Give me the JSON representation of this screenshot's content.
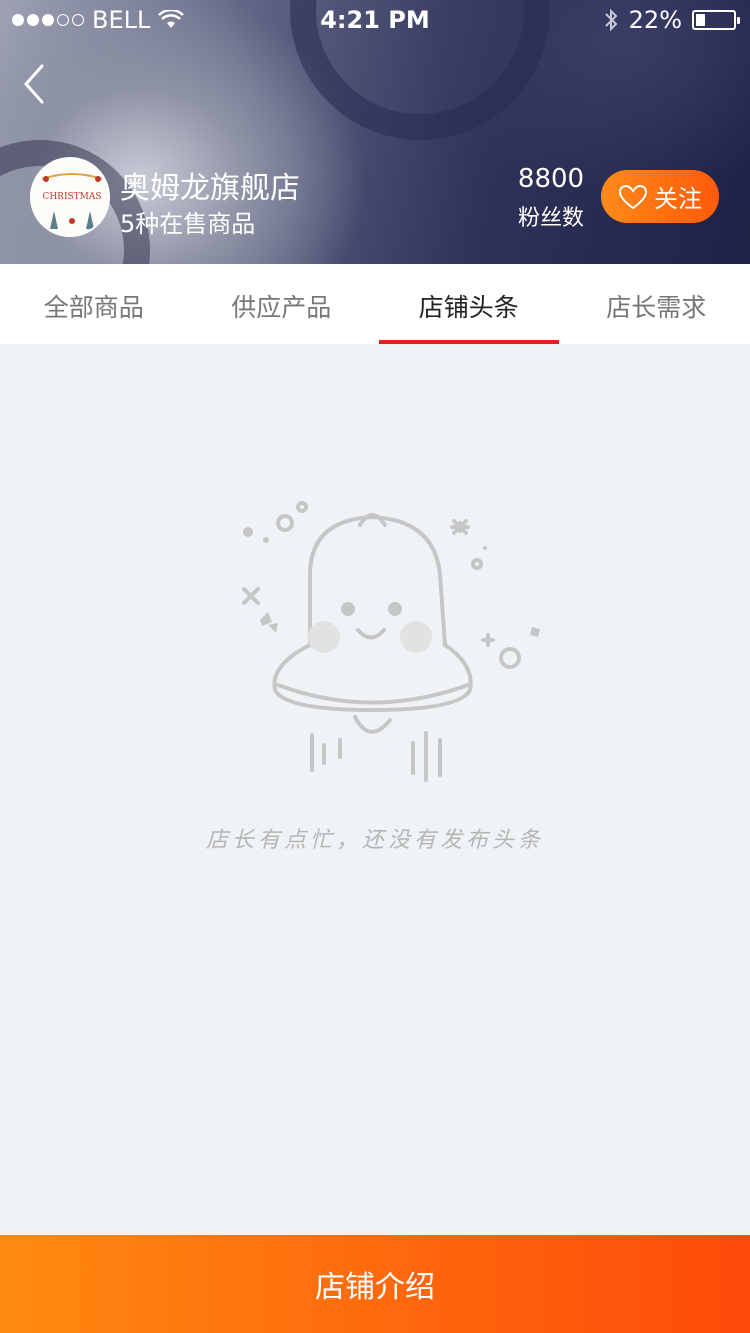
{
  "status_bar": {
    "carrier": "BELL",
    "time": "4:21 PM",
    "battery": "22%",
    "battery_level": 0.22,
    "signal_icon": "signal-dots-icon",
    "wifi_icon": "wifi-icon",
    "bluetooth_icon": "bluetooth-icon"
  },
  "header": {
    "back_icon": "chevron-left-icon",
    "store_name": "奥姆龙旗舰店",
    "store_sub": "5种在售商品",
    "fans_count": "8800",
    "fans_label": "粉丝数",
    "follow_label": "关注",
    "follow_icon": "heart-icon",
    "avatar_text": "CHRISTMAS"
  },
  "tabs": [
    {
      "label": "全部商品",
      "active": false
    },
    {
      "label": "供应产品",
      "active": false
    },
    {
      "label": "店铺头条",
      "active": true
    },
    {
      "label": "店长需求",
      "active": false
    }
  ],
  "empty_state": {
    "icon": "bell-icon",
    "text": "店长有点忙，还没有发布头条"
  },
  "bottom_button": {
    "label": "店铺介绍"
  },
  "colors": {
    "accent_red": "#e0211d",
    "orange_start": "#ff8a10",
    "orange_end": "#ff4a0a",
    "page_bg": "#f0f3f6"
  }
}
